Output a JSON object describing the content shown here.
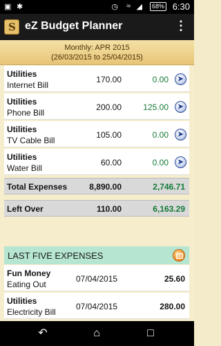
{
  "status": {
    "time": "6:30",
    "battery": "68%",
    "icons": [
      "camera-icon",
      "bug-icon",
      "alarm-icon",
      "wifi-icon",
      "signal-icon",
      "battery-icon"
    ]
  },
  "app": {
    "title": "eZ Budget Planner",
    "icon_letter": "S"
  },
  "period": {
    "line1": "Monthly: APR 2015",
    "line2": "(26/03/2015 to 25/04/2015)"
  },
  "budget_rows": [
    {
      "category": "Utilities",
      "sub": "Internet Bill",
      "budget": "170.00",
      "spent": "0.00"
    },
    {
      "category": "Utilities",
      "sub": "Phone Bill",
      "budget": "200.00",
      "spent": "125.00"
    },
    {
      "category": "Utilities",
      "sub": "TV Cable Bill",
      "budget": "105.00",
      "spent": "0.00"
    },
    {
      "category": "Utilities",
      "sub": "Water Bill",
      "budget": "60.00",
      "spent": "0.00"
    }
  ],
  "total": {
    "label": "Total Expenses",
    "budget": "8,890.00",
    "spent": "2,746.71"
  },
  "left_over": {
    "label": "Left Over",
    "budget": "110.00",
    "spent": "6,163.29"
  },
  "last_five": {
    "title": "LAST FIVE EXPENSES",
    "rows": [
      {
        "category": "Fun Money",
        "sub": "Eating Out",
        "date": "07/04/2015",
        "amount": "25.60"
      },
      {
        "category": "Utilities",
        "sub": "Electricity Bill",
        "date": "07/04/2015",
        "amount": "280.00"
      }
    ]
  },
  "colors": {
    "positive": "#137a36",
    "accent_header": "#b6e6d2"
  }
}
